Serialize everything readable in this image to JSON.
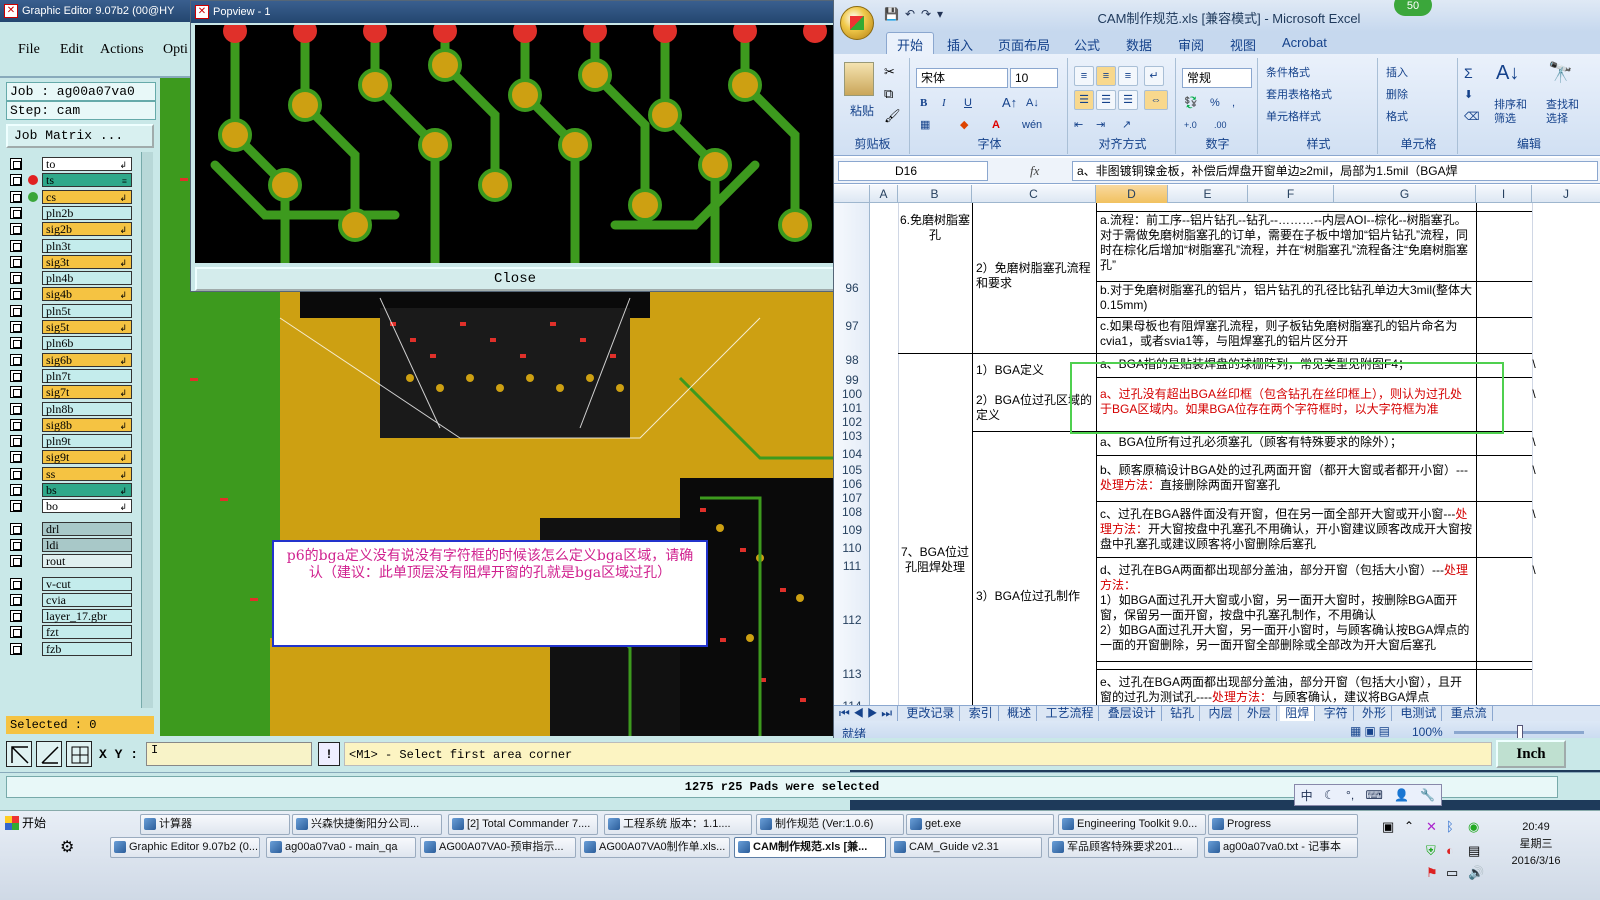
{
  "graphic_editor": {
    "title": "Graphic Editor 9.07b2 (00@HY",
    "menu": [
      "File",
      "Edit",
      "Actions",
      "Opti"
    ],
    "job_line": "Job : ag00a07va0",
    "step_line": "Step: cam",
    "job_matrix_label": "Job Matrix ...",
    "layers": [
      {
        "name": "to",
        "fill": "#ffffff",
        "mark": "↲",
        "dot": ""
      },
      {
        "name": "ts",
        "fill": "#2fa88a",
        "mark": "≡",
        "dot": "#e02020",
        "sel": true
      },
      {
        "name": "cs",
        "fill": "#f5c342",
        "mark": "↲",
        "dot": "#3aa63a"
      },
      {
        "name": "pln2b",
        "fill": "#c4ecec",
        "mark": "",
        "dot": ""
      },
      {
        "name": "sig2b",
        "fill": "#f5c342",
        "mark": "↲",
        "dot": ""
      },
      {
        "name": "pln3t",
        "fill": "#c4ecec",
        "mark": "",
        "dot": ""
      },
      {
        "name": "sig3t",
        "fill": "#f5c342",
        "mark": "↲",
        "dot": ""
      },
      {
        "name": "pln4b",
        "fill": "#c4ecec",
        "mark": "",
        "dot": ""
      },
      {
        "name": "sig4b",
        "fill": "#f5c342",
        "mark": "↲",
        "dot": ""
      },
      {
        "name": "pln5t",
        "fill": "#c4ecec",
        "mark": "",
        "dot": ""
      },
      {
        "name": "sig5t",
        "fill": "#f5c342",
        "mark": "↲",
        "dot": ""
      },
      {
        "name": "pln6b",
        "fill": "#c4ecec",
        "mark": "",
        "dot": ""
      },
      {
        "name": "sig6b",
        "fill": "#f5c342",
        "mark": "↲",
        "dot": ""
      },
      {
        "name": "pln7t",
        "fill": "#c4ecec",
        "mark": "",
        "dot": ""
      },
      {
        "name": "sig7t",
        "fill": "#f5c342",
        "mark": "↲",
        "dot": ""
      },
      {
        "name": "pln8b",
        "fill": "#c4ecec",
        "mark": "",
        "dot": ""
      },
      {
        "name": "sig8b",
        "fill": "#f5c342",
        "mark": "↲",
        "dot": ""
      },
      {
        "name": "pln9t",
        "fill": "#c4ecec",
        "mark": "",
        "dot": ""
      },
      {
        "name": "sig9t",
        "fill": "#f5c342",
        "mark": "↲",
        "dot": ""
      },
      {
        "name": "ss",
        "fill": "#f5c342",
        "mark": "↲",
        "dot": ""
      },
      {
        "name": "bs",
        "fill": "#2fa88a",
        "mark": "↲",
        "dot": ""
      },
      {
        "name": "bo",
        "fill": "#ffffff",
        "mark": "↲",
        "dot": ""
      },
      {
        "name": "drl",
        "fill": "#a8c8c8",
        "mark": "",
        "dot": ""
      },
      {
        "name": "ldi",
        "fill": "#a8c8c8",
        "mark": "",
        "dot": ""
      },
      {
        "name": "rout",
        "fill": "#e0f0f0",
        "mark": "",
        "dot": ""
      },
      {
        "name": "v-cut",
        "fill": "#c4ecec",
        "mark": "",
        "dot": ""
      },
      {
        "name": "cvia",
        "fill": "#c4ecec",
        "mark": "",
        "dot": ""
      },
      {
        "name": "layer_17.gbr",
        "fill": "#c4ecec",
        "mark": "",
        "dot": ""
      },
      {
        "name": "fzt",
        "fill": "#c4ecec",
        "mark": "",
        "dot": ""
      },
      {
        "name": "fzb",
        "fill": "#c4ecec",
        "mark": "",
        "dot": ""
      }
    ],
    "selected_label": "Selected : 0",
    "xy_label": "X Y :",
    "xy_value": "I",
    "prompt_text": "<M1> - Select first area corner",
    "units_button": "Inch",
    "status_text": "1275 r25 Pads were selected",
    "comment_text": "p6的bga定义没有说没有字符框的时候该怎么定义bga区域，请确认（建议：此单顶层没有阻焊开窗的孔就是bga区域过孔）",
    "colors": {
      "board_green": "#3d9a1e",
      "copper": "#cda012",
      "pad_red": "#e0302a",
      "panel": "#c9e8e8"
    }
  },
  "popview": {
    "title": "Popview - 1",
    "close_label": "Close"
  },
  "excel": {
    "title": "CAM制作规范.xls  [兼容模式] - Microsoft Excel",
    "badge": "50",
    "tabs": [
      "开始",
      "插入",
      "页面布局",
      "公式",
      "数据",
      "审阅",
      "视图",
      "Acrobat"
    ],
    "ribbon": {
      "paste": "粘贴",
      "clipboard": "剪贴板",
      "font_name": "宋体",
      "font_size": "10",
      "font_group": "字体",
      "align_group": "对齐方式",
      "number_format": "常规",
      "number_group": "数字",
      "cond_format": "条件格式",
      "table_format": "套用表格格式",
      "cell_style": "单元格样式",
      "style_group": "样式",
      "insert": "插入",
      "delete": "删除",
      "format": "格式",
      "cells_group": "单元格",
      "sort_filter": "排序和\n筛选",
      "find_select": "查找和\n选择",
      "edit_group": "编辑"
    },
    "name_box": "D16",
    "formula": "a、非图镀铜镍金板，补偿后焊盘开窗单边≥2mil，局部为1.5mil（BGA焊",
    "columns": [
      "A",
      "B",
      "C",
      "D",
      "E",
      "F",
      "G",
      "I",
      "J"
    ],
    "rows": [
      {
        "n": "96",
        "b": "6.免磨树脂塞孔",
        "c": "2）免磨树脂塞孔流程和要求",
        "d": "a.流程：前工序--铝片钻孔--钻孔--………--内层AOI--棕化--树脂塞孔。对于需做免磨树脂塞孔的订单，需要在子板中增加“铝片钻孔”流程，同时在棕化后增加“树脂塞孔”流程，并在“树脂塞孔”流程备注“免磨树脂塞孔”",
        "i": ""
      },
      {
        "n": "97",
        "d": "b.对于免磨树脂塞孔的铝片，铝片钻孔的孔径比钻孔单边大3mil(整体大0.15mm)",
        "i": ""
      },
      {
        "n": "98",
        "d": "c.如果母板也有阻焊塞孔流程，则子板钻免磨树脂塞孔的铝片命名为cvia1，或者svia1等，与阻焊塞孔的铝片区分开",
        "i": ""
      },
      {
        "n": "99",
        "c": "1）BGA定义",
        "d": "a、BGA指的是贴装焊盘的球栅阵列，常见类型见附图F4；",
        "i": "\\"
      },
      {
        "n": "100",
        "c": "2）BGA位过孔区域的定义",
        "d": "a、过孔没有超出BGA丝印框（包含钻孔在丝印框上），则认为过孔处于BGA区域内。如果BGA位存在两个字符框时，以大字符框为准",
        "i": "\\"
      },
      {
        "n": "104",
        "d": "a、BGA位所有过孔必须塞孔（顾客有特殊要求的除外）；",
        "i": "\\"
      },
      {
        "n": "106",
        "d": "b、顾客原稿设计BGA处的过孔两面开窗（都开大窗或者都开小窗）---处理方法：直接删除两面开窗塞孔",
        "i": "\\"
      },
      {
        "n": "110",
        "d": "c、过孔在BGA器件面没有开窗，但在另一面全部开大窗或开小窗---处理方法：开大窗按盘中孔塞孔不用确认，开小窗建议顾客改成开大窗按盘中孔塞孔或建议顾客将小窗删除后塞孔",
        "i": "\\"
      },
      {
        "n": "112",
        "b": "7、BGA位过孔阻焊处理",
        "c": "3）BGA位过孔制作",
        "d": "d、过孔在BGA两面都出现部分盖油，部分开窗（包括大小窗）---处理方法：\n1）如BGA面过孔开大窗或小窗，另一面开大窗时，按删除BGA面开窗，保留另一面开窗，按盘中孔塞孔制作，不用确认\n2）如BGA面过孔开大窗，另一面开小窗时，与顾客确认按BGA焊点的一面的开窗删除，另一面开窗全部删除或全部改为开大窗后塞孔",
        "i": "\\"
      },
      {
        "n": "114",
        "d": "e、过孔在BGA两面都出现部分盖油，部分开窗（包括大小窗），且开窗的过孔为测试孔----处理方法：与顾客确认，建议将BGA焊点",
        "i": ""
      }
    ],
    "row_numbers": [
      "96",
      "97",
      "98",
      "99",
      "100",
      "101",
      "102",
      "103",
      "104",
      "105",
      "106",
      "107",
      "108",
      "109",
      "110",
      "111",
      "112",
      "113",
      "114"
    ],
    "sheet_tabs": [
      "更改记录",
      "索引",
      "概述",
      "工艺流程",
      "叠层设计",
      "钻孔",
      "内层",
      "外层",
      "阻焊",
      "字符",
      "外形",
      "电测试",
      "重点流"
    ],
    "active_sheet": "阻焊",
    "status_ready": "就绪",
    "zoom": "100%"
  },
  "taskbar": {
    "start_label": "开始",
    "row1": [
      "计算器",
      "兴森快捷衡阳分公司...",
      "[2] Total Commander 7....",
      "工程系统  版本：1.1....",
      "制作规范 (Ver:1.0.6)",
      "get.exe",
      "Engineering Toolkit 9.0...",
      "Progress"
    ],
    "row2": [
      "Graphic Editor 9.07b2 (0...",
      "ag00a07va0 - main_qa",
      "AG00A07VA0-预审指示...",
      "AG00A07VA0制作单.xls...",
      "CAM制作规范.xls [兼...",
      "CAM_Guide v2.31",
      "军品顾客特殊要求201...",
      "ag00a07va0.txt - 记事本"
    ],
    "active_task": "CAM制作规范.xls [兼...",
    "clock_time": "20:49",
    "clock_day": "星期三",
    "clock_date": "2016/3/16",
    "ime_label": "中"
  }
}
